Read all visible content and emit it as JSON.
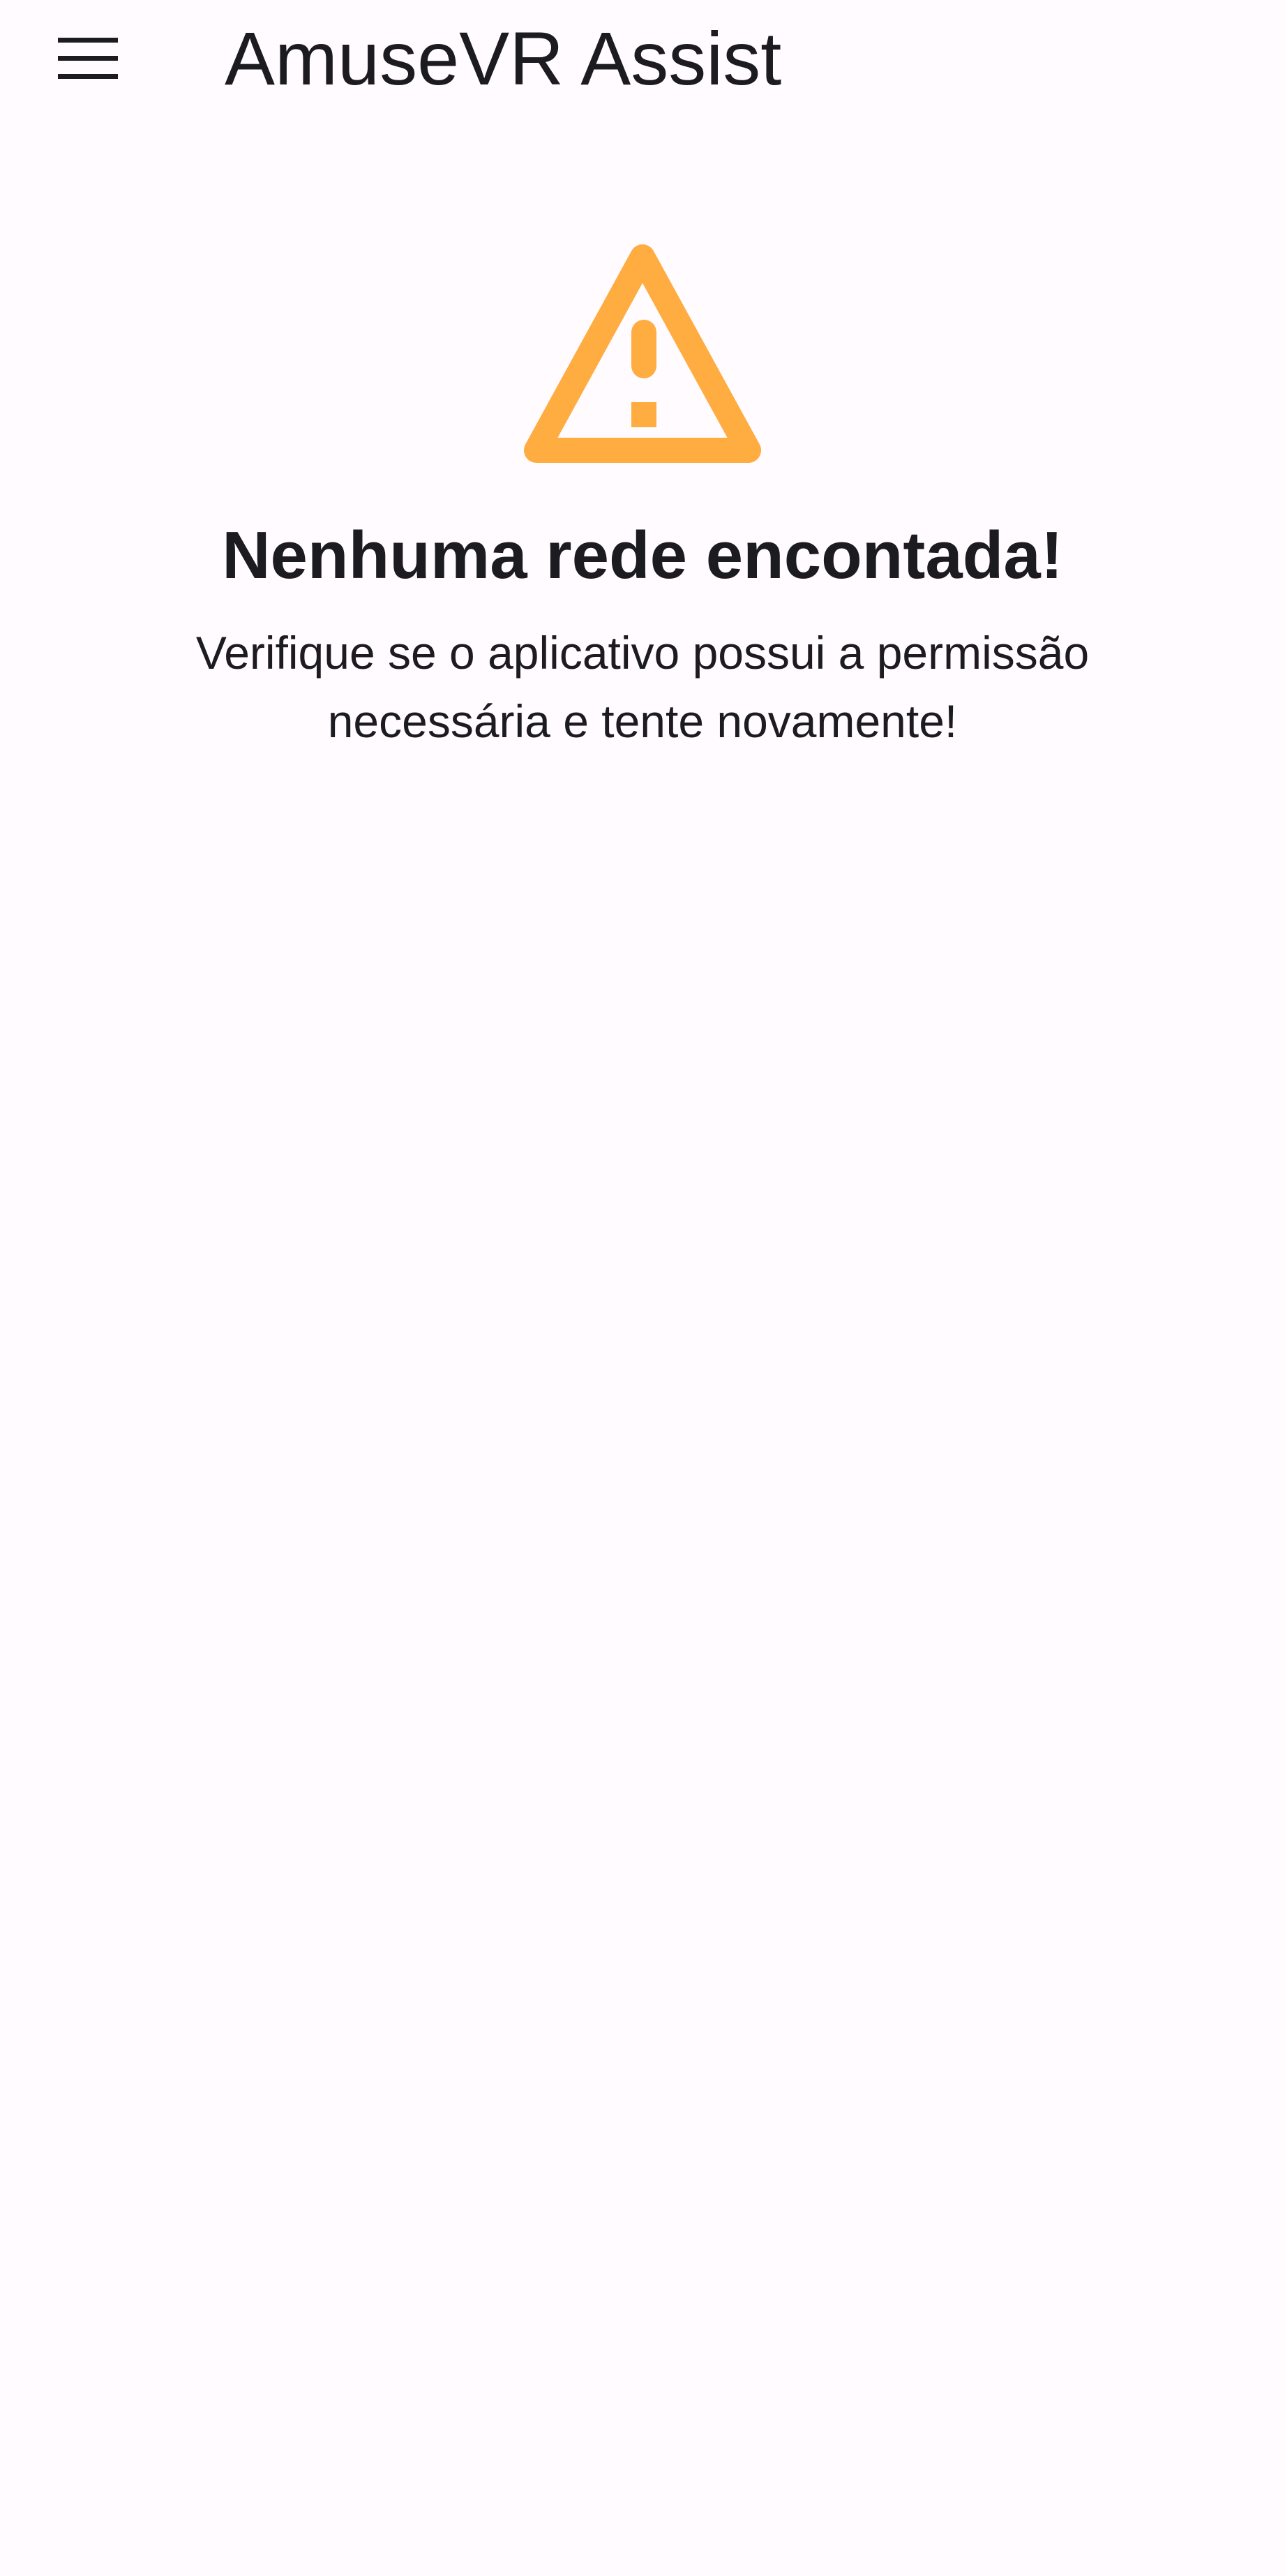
{
  "app_bar": {
    "title": "AmuseVR Assist",
    "menu_icon": "menu-icon"
  },
  "empty_state": {
    "icon": "warning-icon",
    "icon_color": "#ffac40",
    "title": "Nenhuma rede encontada!",
    "message": "Verifique se o aplicativo possui a permissão necessária e tente novamente!"
  },
  "colors": {
    "background": "#fffbfe",
    "text": "#1c1b1f"
  }
}
